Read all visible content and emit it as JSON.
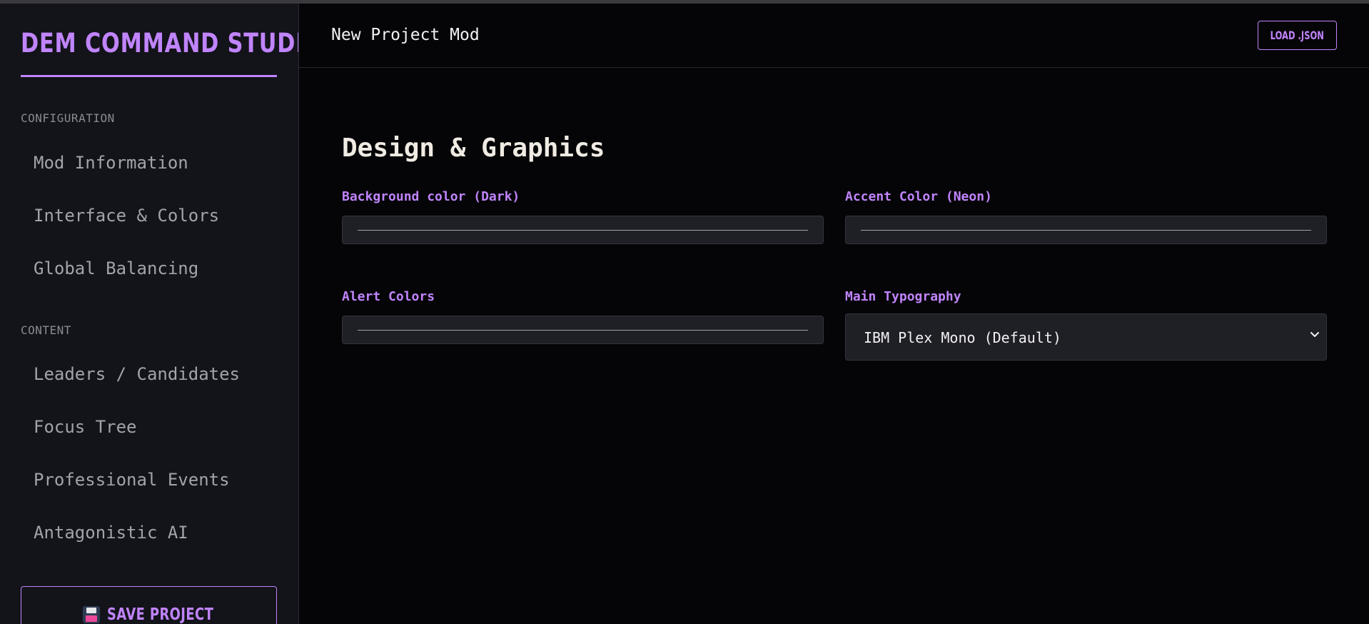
{
  "sidebar": {
    "brand": "DEM COMMAND STUDIO",
    "sections": [
      {
        "label": "CONFIGURATION",
        "items": [
          "Mod Information",
          "Interface & Colors",
          "Global Balancing"
        ]
      },
      {
        "label": "CONTENT",
        "items": [
          "Leaders / Candidates",
          "Focus Tree",
          "Professional Events",
          "Antagonistic AI"
        ]
      }
    ],
    "save_button": "SAVE PROJECT",
    "save_icon": "floppy-disk-icon"
  },
  "header": {
    "project_title": "New Project Mod",
    "load_button": "LOAD .JSON"
  },
  "main": {
    "title": "Design & Graphics",
    "fields": {
      "background_color": {
        "label": "Background color (Dark)"
      },
      "accent_color": {
        "label": "Accent Color (Neon)"
      },
      "alert_colors": {
        "label": "Alert Colors"
      },
      "main_typography": {
        "label": "Main Typography",
        "value": "IBM Plex Mono (Default)"
      }
    }
  },
  "colors": {
    "accent": "#c084fc",
    "sidebar_bg": "#13131a",
    "main_bg": "#050507",
    "input_bg": "#1f1f26"
  }
}
